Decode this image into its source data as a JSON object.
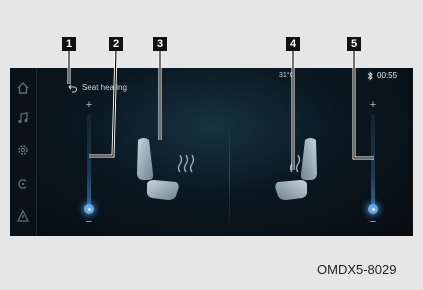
{
  "header": {
    "title": "Seat heating",
    "temperature": "31°C",
    "clock": "00:55"
  },
  "sidebar": {
    "items": [
      {
        "icon": "home-icon"
      },
      {
        "icon": "music-icon"
      },
      {
        "icon": "settings-icon"
      },
      {
        "icon": "app-icon"
      },
      {
        "icon": "navigation-icon"
      }
    ]
  },
  "controls": {
    "plus": "+",
    "minus": "−",
    "driver_level": 0,
    "passenger_level": 0
  },
  "callouts": [
    "1",
    "2",
    "3",
    "4",
    "5"
  ],
  "reference_code": "OMDX5-8029",
  "colors": {
    "accent": "#6aa9e6",
    "screen_bg": "#0b1720"
  }
}
